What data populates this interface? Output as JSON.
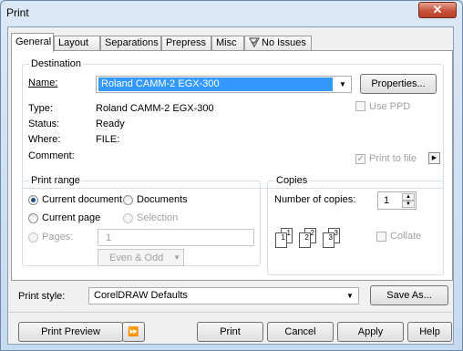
{
  "window": {
    "title": "Print",
    "close_glyph": "✕"
  },
  "tabs": [
    {
      "label": "General",
      "active": true
    },
    {
      "label": "Layout"
    },
    {
      "label": "Separations"
    },
    {
      "label": "Prepress"
    },
    {
      "label": "Misc"
    },
    {
      "label": "No Issues",
      "icon": "no-issues-icon"
    }
  ],
  "destination": {
    "group_label": "Destination",
    "name_label": "Name:",
    "name_value": "Roland CAMM-2 EGX-300",
    "properties_button": "Properties...",
    "type_label": "Type:",
    "type_value": "Roland CAMM-2 EGX-300",
    "status_label": "Status:",
    "status_value": "Ready",
    "where_label": "Where:",
    "where_value": "FILE:",
    "comment_label": "Comment:",
    "use_ppd_label": "Use PPD",
    "use_ppd_checked": false,
    "print_to_file_label": "Print to file",
    "print_to_file_checked": true
  },
  "print_range": {
    "group_label": "Print range",
    "current_document": "Current document",
    "documents": "Documents",
    "current_page": "Current page",
    "selection": "Selection",
    "pages_label": "Pages:",
    "pages_value": "1",
    "page_set_value": "Even & Odd",
    "selected": "current_document"
  },
  "copies": {
    "group_label": "Copies",
    "number_label": "Number of copies:",
    "number_value": "1",
    "collate_label": "Collate",
    "collate_checked": false,
    "icon_sheets": [
      "1",
      "1",
      "2",
      "2",
      "3",
      "3"
    ]
  },
  "print_style": {
    "label": "Print style:",
    "value": "CorelDRAW Defaults",
    "save_as_button": "Save As..."
  },
  "buttons": {
    "print_preview": "Print Preview",
    "expand_icon": "double-arrow-icon",
    "print": "Print",
    "cancel": "Cancel",
    "apply": "Apply",
    "help": "Help"
  }
}
